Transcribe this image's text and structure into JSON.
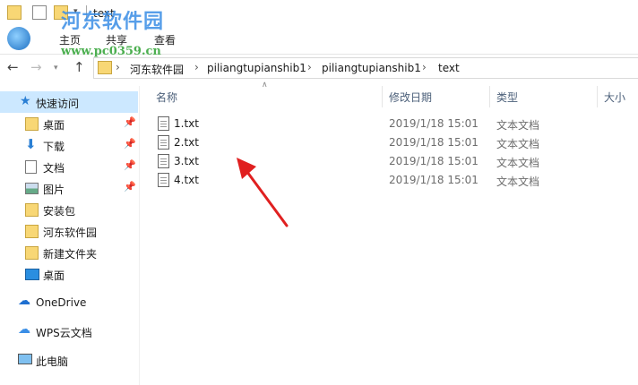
{
  "title": "text",
  "watermark": {
    "site": "河东软件园",
    "url": "www.pc0359.cn"
  },
  "ribbon": {
    "tabs": [
      "主页",
      "共享",
      "查看"
    ]
  },
  "address": {
    "crumbs": [
      "河东软件园",
      "piliangtupianshib1",
      "piliangtupianshib1",
      "text"
    ]
  },
  "sidebar": {
    "items": [
      {
        "label": "快速访问",
        "icon": "star-icon",
        "selected": true
      },
      {
        "label": "桌面",
        "icon": "folder-icon",
        "pinned": true
      },
      {
        "label": "下载",
        "icon": "download-icon",
        "pinned": true
      },
      {
        "label": "文档",
        "icon": "document-icon",
        "pinned": true
      },
      {
        "label": "图片",
        "icon": "picture-icon",
        "pinned": true
      },
      {
        "label": "安装包",
        "icon": "folder-icon"
      },
      {
        "label": "河东软件园",
        "icon": "folder-icon"
      },
      {
        "label": "新建文件夹",
        "icon": "folder-icon"
      },
      {
        "label": "桌面",
        "icon": "desktop-icon"
      },
      {
        "label": "OneDrive",
        "icon": "cloud-icon"
      },
      {
        "label": "WPS云文档",
        "icon": "cloud-outline-icon"
      },
      {
        "label": "此电脑",
        "icon": "computer-icon"
      }
    ]
  },
  "columns": {
    "name": "名称",
    "date": "修改日期",
    "type": "类型",
    "size": "大小"
  },
  "files": [
    {
      "name": "1.txt",
      "date": "2019/1/18 15:01",
      "type": "文本文档"
    },
    {
      "name": "2.txt",
      "date": "2019/1/18 15:01",
      "type": "文本文档"
    },
    {
      "name": "3.txt",
      "date": "2019/1/18 15:01",
      "type": "文本文档"
    },
    {
      "name": "4.txt",
      "date": "2019/1/18 15:01",
      "type": "文本文档"
    }
  ],
  "colors": {
    "accent": "#1e6fd0",
    "selection": "#cce8ff",
    "arrow": "#e02020",
    "folder": "#f8d775"
  }
}
